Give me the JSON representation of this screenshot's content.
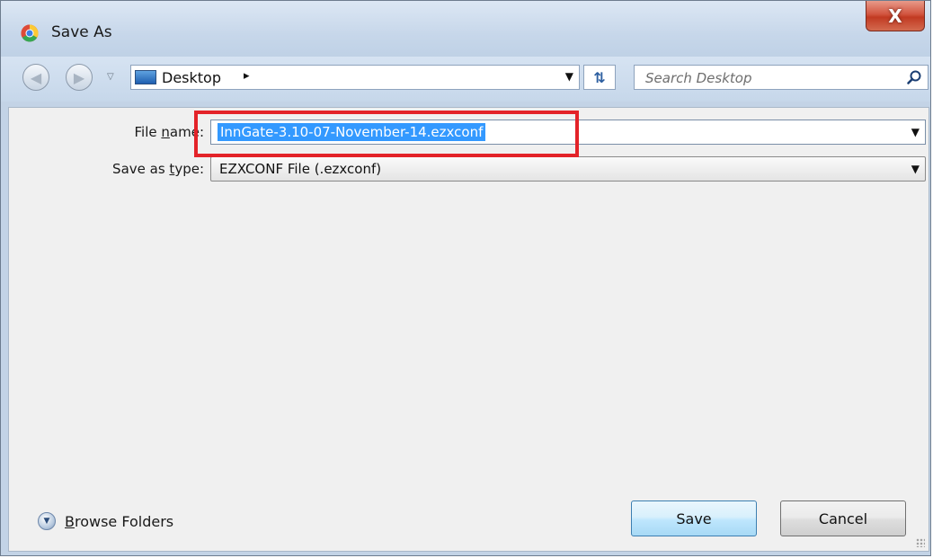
{
  "window": {
    "title": "Save As",
    "close_label": "X"
  },
  "navbar": {
    "location": "Desktop",
    "search_placeholder": "Search Desktop"
  },
  "form": {
    "file_name_label_pre": "File ",
    "file_name_label_accel": "n",
    "file_name_label_post": "ame:",
    "file_name_value": "InnGate-3.10-07-November-14.ezxconf",
    "save_type_label_pre": "Save as ",
    "save_type_label_accel": "t",
    "save_type_label_post": "ype:",
    "save_type_value": "EZXCONF File (.ezxconf)"
  },
  "footer": {
    "browse_accel": "B",
    "browse_rest": "rowse Folders",
    "save_label": "Save",
    "cancel_label": "Cancel"
  },
  "colors": {
    "highlight": "#e32329",
    "selection": "#3399ff",
    "close": "#c13a22"
  },
  "icons": {
    "app": "chrome-icon",
    "back": "back-arrow-icon",
    "forward": "forward-arrow-icon",
    "refresh": "refresh-icon",
    "search": "search-icon",
    "browse": "chevron-down-circle-icon"
  }
}
